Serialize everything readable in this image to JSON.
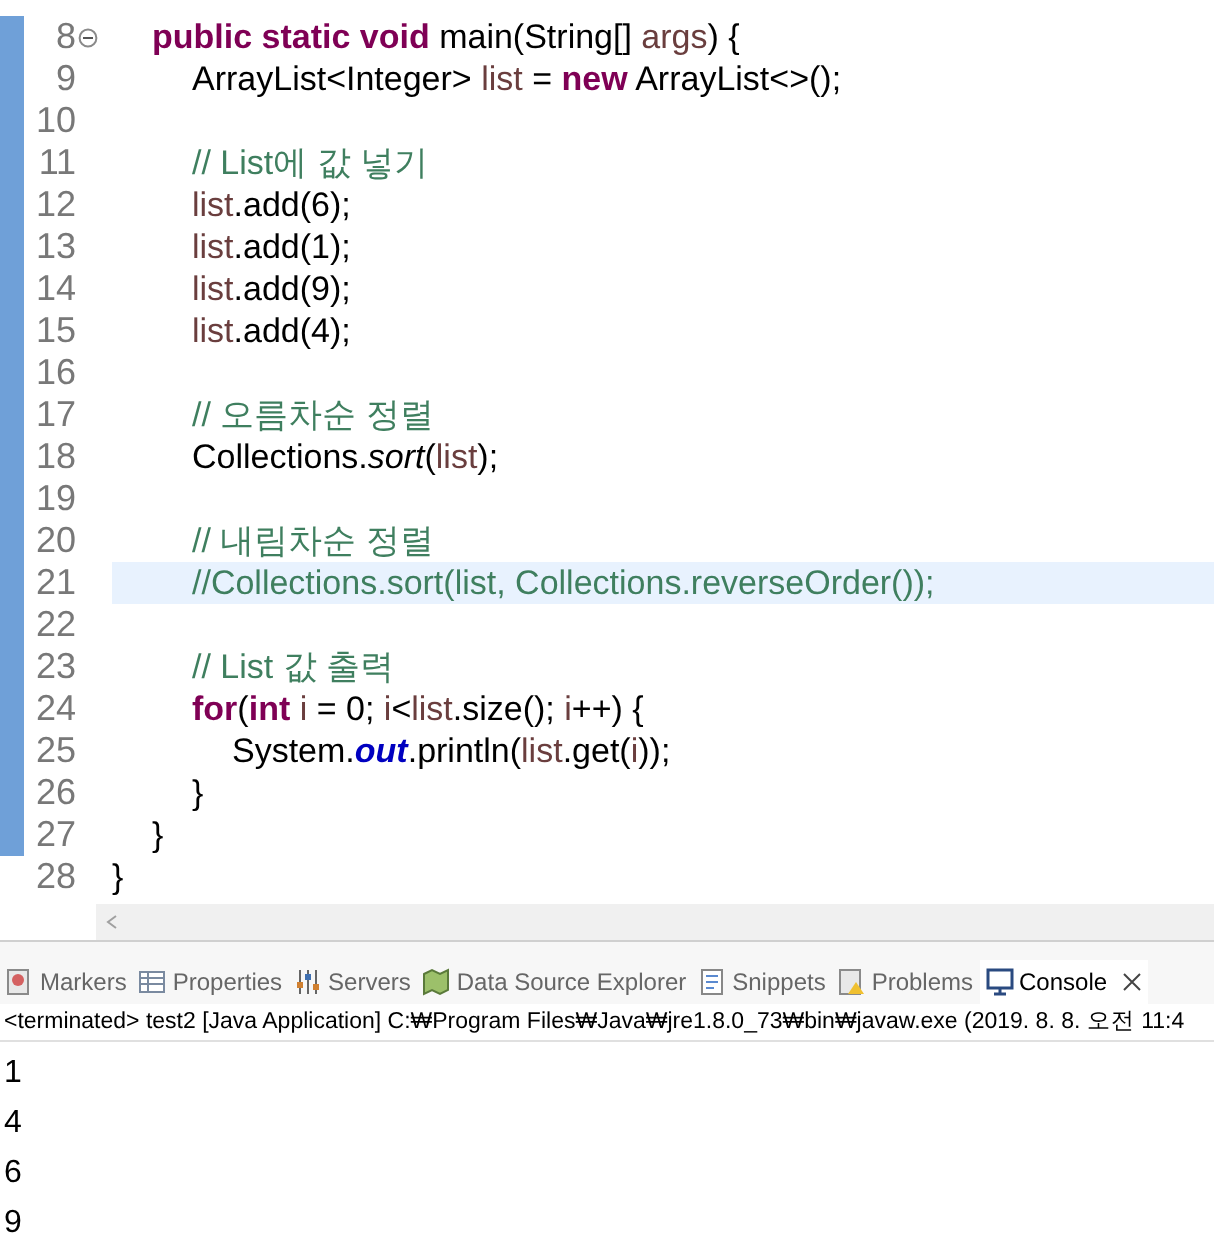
{
  "editor": {
    "lines": [
      {
        "number": "8",
        "folded": false,
        "highlighted": false,
        "tokens": [
          {
            "text": "\tpublic static void",
            "kind": "keyword"
          },
          {
            "text": " main(String[] ",
            "kind": "plain"
          },
          {
            "text": "args",
            "kind": "local"
          },
          {
            "text": ") {",
            "kind": "plain"
          }
        ]
      },
      {
        "number": "9",
        "highlighted": false,
        "tokens": [
          {
            "text": "\t\tArrayList<Integer> ",
            "kind": "plain"
          },
          {
            "text": "list",
            "kind": "local"
          },
          {
            "text": " = ",
            "kind": "plain"
          },
          {
            "text": "new",
            "kind": "keyword"
          },
          {
            "text": " ArrayList<>();",
            "kind": "plain"
          }
        ]
      },
      {
        "number": "10",
        "highlighted": false
      },
      {
        "number": "11",
        "highlighted": false,
        "tokens": [
          {
            "text": "\t\t// List에 값 넣기",
            "kind": "comment"
          }
        ]
      },
      {
        "number": "12",
        "highlighted": false,
        "tokens": [
          {
            "text": "\t\tlist",
            "kind": "local"
          },
          {
            "text": ".add(6);",
            "kind": "plain"
          }
        ]
      },
      {
        "number": "13",
        "highlighted": false,
        "tokens": [
          {
            "text": "\t\tlist",
            "kind": "local"
          },
          {
            "text": ".add(1);",
            "kind": "plain"
          }
        ]
      },
      {
        "number": "14",
        "highlighted": false,
        "tokens": [
          {
            "text": "\t\tlist",
            "kind": "local"
          },
          {
            "text": ".add(9);",
            "kind": "plain"
          }
        ]
      },
      {
        "number": "15",
        "highlighted": false,
        "tokens": [
          {
            "text": "\t\tlist",
            "kind": "local"
          },
          {
            "text": ".add(4);",
            "kind": "plain"
          }
        ]
      },
      {
        "number": "16",
        "highlighted": false
      },
      {
        "number": "17",
        "highlighted": false,
        "tokens": [
          {
            "text": "\t\t// 오름차순 정렬",
            "kind": "comment"
          }
        ]
      },
      {
        "number": "18",
        "highlighted": false,
        "tokens": [
          {
            "text": "\t\tCollections.",
            "kind": "plain"
          },
          {
            "text": "sort",
            "kind": "static"
          },
          {
            "text": "(",
            "kind": "plain"
          },
          {
            "text": "list",
            "kind": "local"
          },
          {
            "text": ");",
            "kind": "plain"
          }
        ]
      },
      {
        "number": "19",
        "highlighted": false
      },
      {
        "number": "20",
        "highlighted": false,
        "tokens": [
          {
            "text": "\t\t// 내림차순 정렬",
            "kind": "comment"
          }
        ]
      },
      {
        "number": "21",
        "highlighted": true,
        "tokens": [
          {
            "text": "\t\t//Collections.sort(list, Collections.reverseOrder());",
            "kind": "comment"
          }
        ]
      },
      {
        "number": "22",
        "highlighted": false
      },
      {
        "number": "23",
        "highlighted": false,
        "tokens": [
          {
            "text": "\t\t// List 값 출력",
            "kind": "comment"
          }
        ]
      },
      {
        "number": "24",
        "highlighted": false,
        "tokens": [
          {
            "text": "\t\tfor",
            "kind": "keyword"
          },
          {
            "text": "(",
            "kind": "plain"
          },
          {
            "text": "int",
            "kind": "keyword"
          },
          {
            "text": " i",
            "kind": "local"
          },
          {
            "text": " = 0; ",
            "kind": "plain"
          },
          {
            "text": "i",
            "kind": "local"
          },
          {
            "text": "<",
            "kind": "plain"
          },
          {
            "text": "list",
            "kind": "local"
          },
          {
            "text": ".size(); ",
            "kind": "plain"
          },
          {
            "text": "i",
            "kind": "local"
          },
          {
            "text": "++) {",
            "kind": "plain"
          }
        ]
      },
      {
        "number": "25",
        "highlighted": false,
        "tokens": [
          {
            "text": "\t\t\tSystem.",
            "kind": "plain"
          },
          {
            "text": "out",
            "kind": "field"
          },
          {
            "text": ".println(",
            "kind": "plain"
          },
          {
            "text": "list",
            "kind": "local"
          },
          {
            "text": ".get(",
            "kind": "plain"
          },
          {
            "text": "i",
            "kind": "local"
          },
          {
            "text": "));",
            "kind": "plain"
          }
        ]
      },
      {
        "number": "26",
        "highlighted": false,
        "tokens": [
          {
            "text": "\t\t}",
            "kind": "plain"
          }
        ]
      },
      {
        "number": "27",
        "highlighted": false,
        "tokens": [
          {
            "text": "\t}",
            "kind": "plain"
          }
        ]
      },
      {
        "number": "28",
        "highlighted": false,
        "tokens": [
          {
            "text": "}",
            "kind": "plain"
          }
        ]
      }
    ]
  },
  "views": {
    "tabs": [
      {
        "label": "Markers",
        "selected": false
      },
      {
        "label": "Properties",
        "selected": false
      },
      {
        "label": "Servers",
        "selected": false
      },
      {
        "label": "Data Source Explorer",
        "selected": false
      },
      {
        "label": "Snippets",
        "selected": false
      },
      {
        "label": "Problems",
        "selected": false
      },
      {
        "label": "Console",
        "selected": true
      }
    ]
  },
  "console": {
    "header": "<terminated> test2 [Java Application] C:₩Program Files₩Java₩jre1.8.0_73₩bin₩javaw.exe (2019. 8. 8. 오전 11:4",
    "output": [
      "1",
      "4",
      "6",
      "9"
    ]
  }
}
